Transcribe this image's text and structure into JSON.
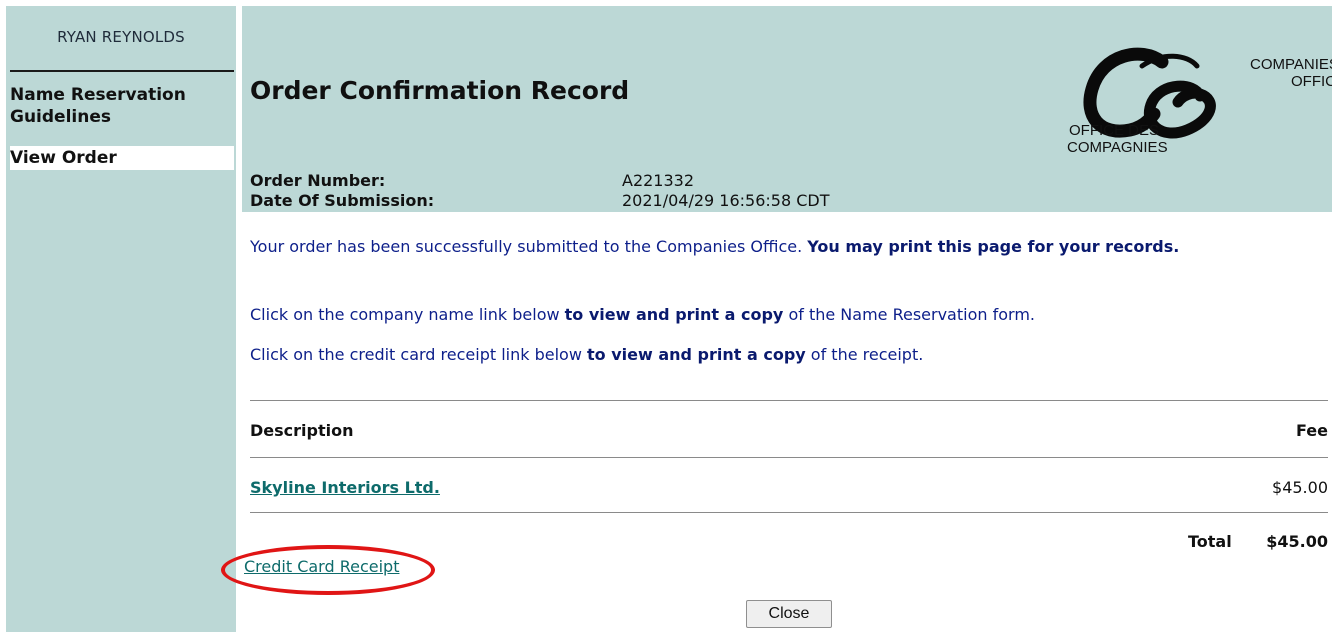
{
  "sidebar": {
    "user_name": "RYAN REYNOLDS",
    "items": [
      {
        "label": "Name Reservation Guidelines"
      },
      {
        "label": "View Order"
      }
    ]
  },
  "header": {
    "title": "Order Confirmation Record",
    "logo": {
      "monogram": "CO",
      "line1": "COMPANIES",
      "line2": "OFFICE",
      "line3": "OFFICE DES",
      "line4": "COMPAGNIES"
    },
    "order_number_label": "Order Number:",
    "order_number_value": "A221332",
    "date_label": "Date Of Submission:",
    "date_value": "2021/04/29 16:56:58 CDT"
  },
  "messages": {
    "submitted_prefix": "Your order has been successfully submitted to the Companies Office. ",
    "submitted_bold": "You may print this page for your records.",
    "company_prefix": "Click on the company name link below ",
    "company_bold": "to view and print a copy",
    "company_suffix": " of the Name Reservation form.",
    "receipt_prefix": "Click on the credit card receipt link below ",
    "receipt_bold": "to view and print a copy",
    "receipt_suffix": " of the receipt."
  },
  "table": {
    "col_description": "Description",
    "col_fee": "Fee",
    "rows": [
      {
        "description": "Skyline Interiors Ltd.",
        "fee": "$45.00"
      }
    ],
    "total_label": "Total",
    "total_value": "$45.00"
  },
  "links": {
    "credit_card_receipt": "Credit Card Receipt"
  },
  "buttons": {
    "close_label": "Close"
  },
  "colors": {
    "panel_bg": "#bcd8d6",
    "message_text": "#0d1f8a",
    "link": "#0e6b6b",
    "highlight": "#e01515"
  }
}
